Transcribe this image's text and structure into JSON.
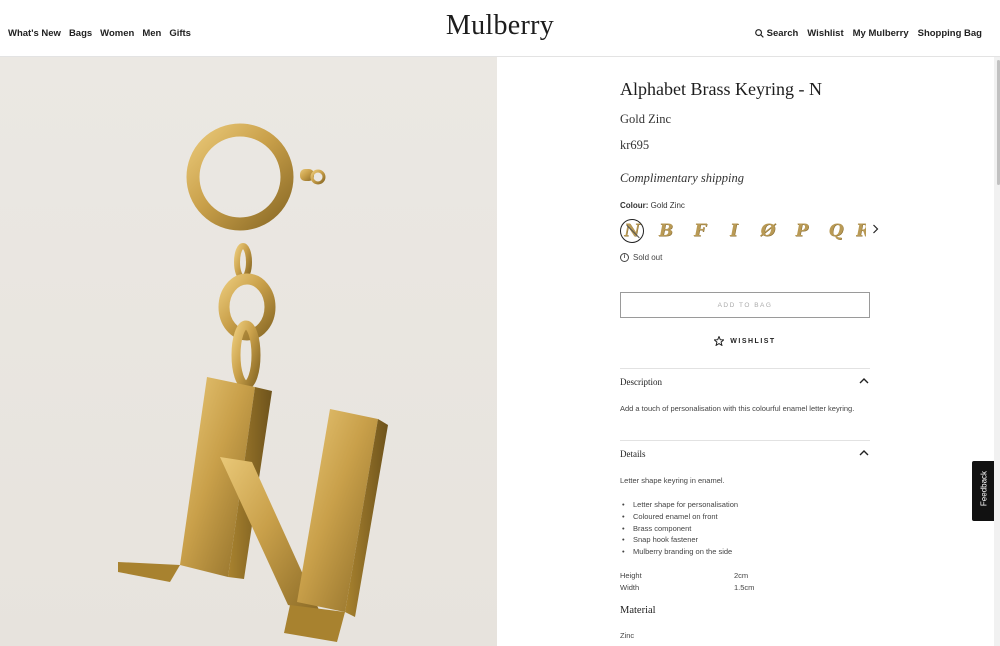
{
  "nav": {
    "left": [
      "What's New",
      "Bags",
      "Women",
      "Men",
      "Gifts"
    ],
    "logo": "Mulberry",
    "right": {
      "search": "Search",
      "wishlist": "Wishlist",
      "account": "My Mulberry",
      "bag": "Shopping Bag"
    }
  },
  "product": {
    "title": "Alphabet Brass Keyring - N",
    "colour_name": "Gold Zinc",
    "price": "kr695",
    "shipping": "Complimentary shipping",
    "colour_label": "Colour:",
    "colour_value": "Gold Zinc",
    "swatches": [
      "N",
      "B",
      "F",
      "I",
      "Ø",
      "P",
      "Q",
      "R"
    ],
    "selected_swatch": "N",
    "stock_status": "Sold out",
    "add_to_bag": "Add to bag",
    "wishlist": "WISHLIST",
    "accent_color": "#b99a55"
  },
  "accordion": {
    "description": {
      "label": "Description",
      "text": "Add a touch of personalisation with this colourful enamel letter keyring."
    },
    "details": {
      "label": "Details",
      "intro": "Letter shape keyring in enamel.",
      "bullets": [
        "Letter shape for personalisation",
        "Coloured enamel on front",
        "Brass component",
        "Snap hook fastener",
        "Mulberry branding on the side"
      ],
      "specs": [
        {
          "key": "Height",
          "value": "2cm"
        },
        {
          "key": "Width",
          "value": "1.5cm"
        }
      ]
    },
    "material": {
      "label": "Material",
      "text": "Zinc"
    }
  },
  "feedback": "Feedback",
  "icons": [
    "search-icon",
    "info-icon",
    "star-icon",
    "chevron-up-icon",
    "chevron-right-icon"
  ]
}
